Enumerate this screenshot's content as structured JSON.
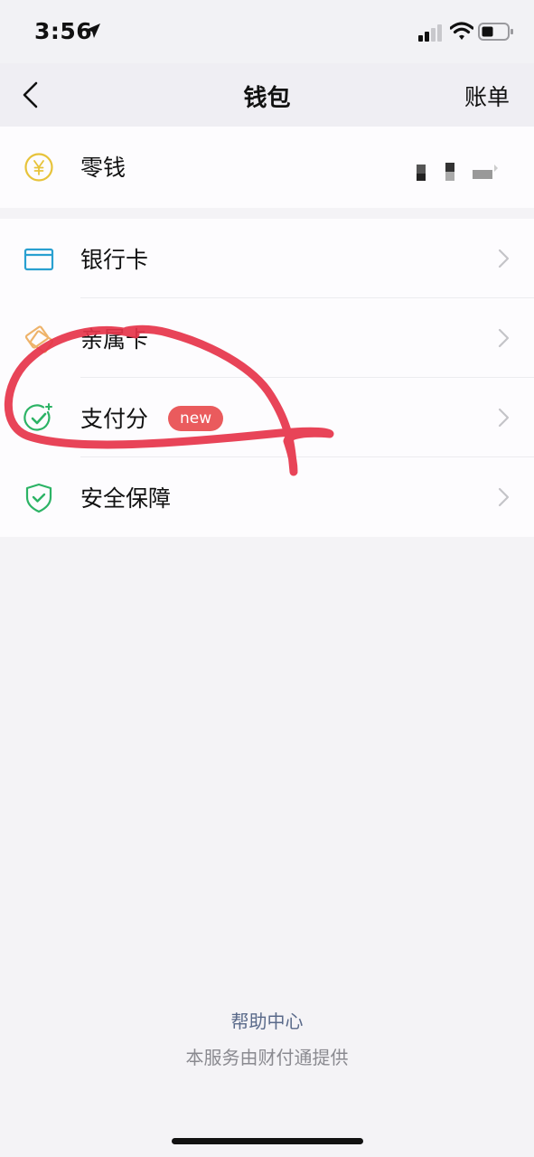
{
  "status_bar": {
    "time": "3:56"
  },
  "nav": {
    "title": "钱包",
    "right_label": "账单"
  },
  "wallet": {
    "label": "零钱"
  },
  "menu": [
    {
      "label": "银行卡"
    },
    {
      "label": "亲属卡"
    },
    {
      "label": "支付分",
      "badge": "new"
    },
    {
      "label": "安全保障"
    }
  ],
  "footer": {
    "help_link": "帮助中心",
    "provider_note": "本服务由财付通提供"
  },
  "colors": {
    "yellow_icon": "#e7c33a",
    "blue_icon": "#29a0d0",
    "orange_icon": "#eeb36a",
    "green_icon": "#2cb365",
    "badge": "#ea5b5d",
    "annotation": "#e6344a"
  }
}
